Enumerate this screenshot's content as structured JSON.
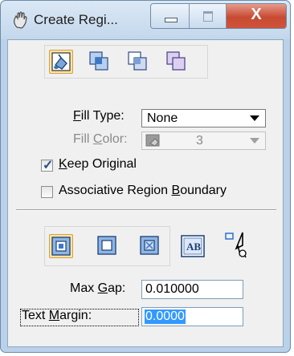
{
  "window": {
    "title": "Create Regi...",
    "buttons": {
      "minimize": "minimize",
      "maximize": "maximize",
      "close": "X"
    }
  },
  "region_methods": {
    "items": [
      {
        "name": "flood-method",
        "selected": true
      },
      {
        "name": "intersection-method",
        "selected": false
      },
      {
        "name": "difference-method",
        "selected": false
      },
      {
        "name": "union-method",
        "selected": false
      }
    ]
  },
  "fill_type": {
    "label_pre": "",
    "label_u": "F",
    "label_post": "ill Type:",
    "value": "None"
  },
  "fill_color": {
    "label_pre": "Fill ",
    "label_u": "C",
    "label_post": "olor:",
    "value": "3",
    "disabled": true
  },
  "keep_original": {
    "label_pre": "",
    "label_u": "K",
    "label_post": "eep Original",
    "checked": true
  },
  "associative": {
    "label_pre": "Associative Region ",
    "label_u": "B",
    "label_post": "oundary",
    "checked": false
  },
  "flood_options": {
    "items": [
      {
        "name": "locate-interior-shapes",
        "selected": true
      },
      {
        "name": "ignore-interior-shapes",
        "selected": false
      },
      {
        "name": "locate-interior-text",
        "selected": false
      }
    ],
    "text_button": "AB"
  },
  "max_gap": {
    "label_pre": "Max ",
    "label_u": "G",
    "label_post": "ap:",
    "value": "0.010000"
  },
  "text_margin": {
    "label_pre": "Text ",
    "label_u": "M",
    "label_post": "argin:",
    "value": "0.0000"
  },
  "colors": {
    "selected_fill": "#fce4a6",
    "selected_border": "#d59f3b",
    "highlight": "#3399ff",
    "close_red": "#c74a32"
  }
}
